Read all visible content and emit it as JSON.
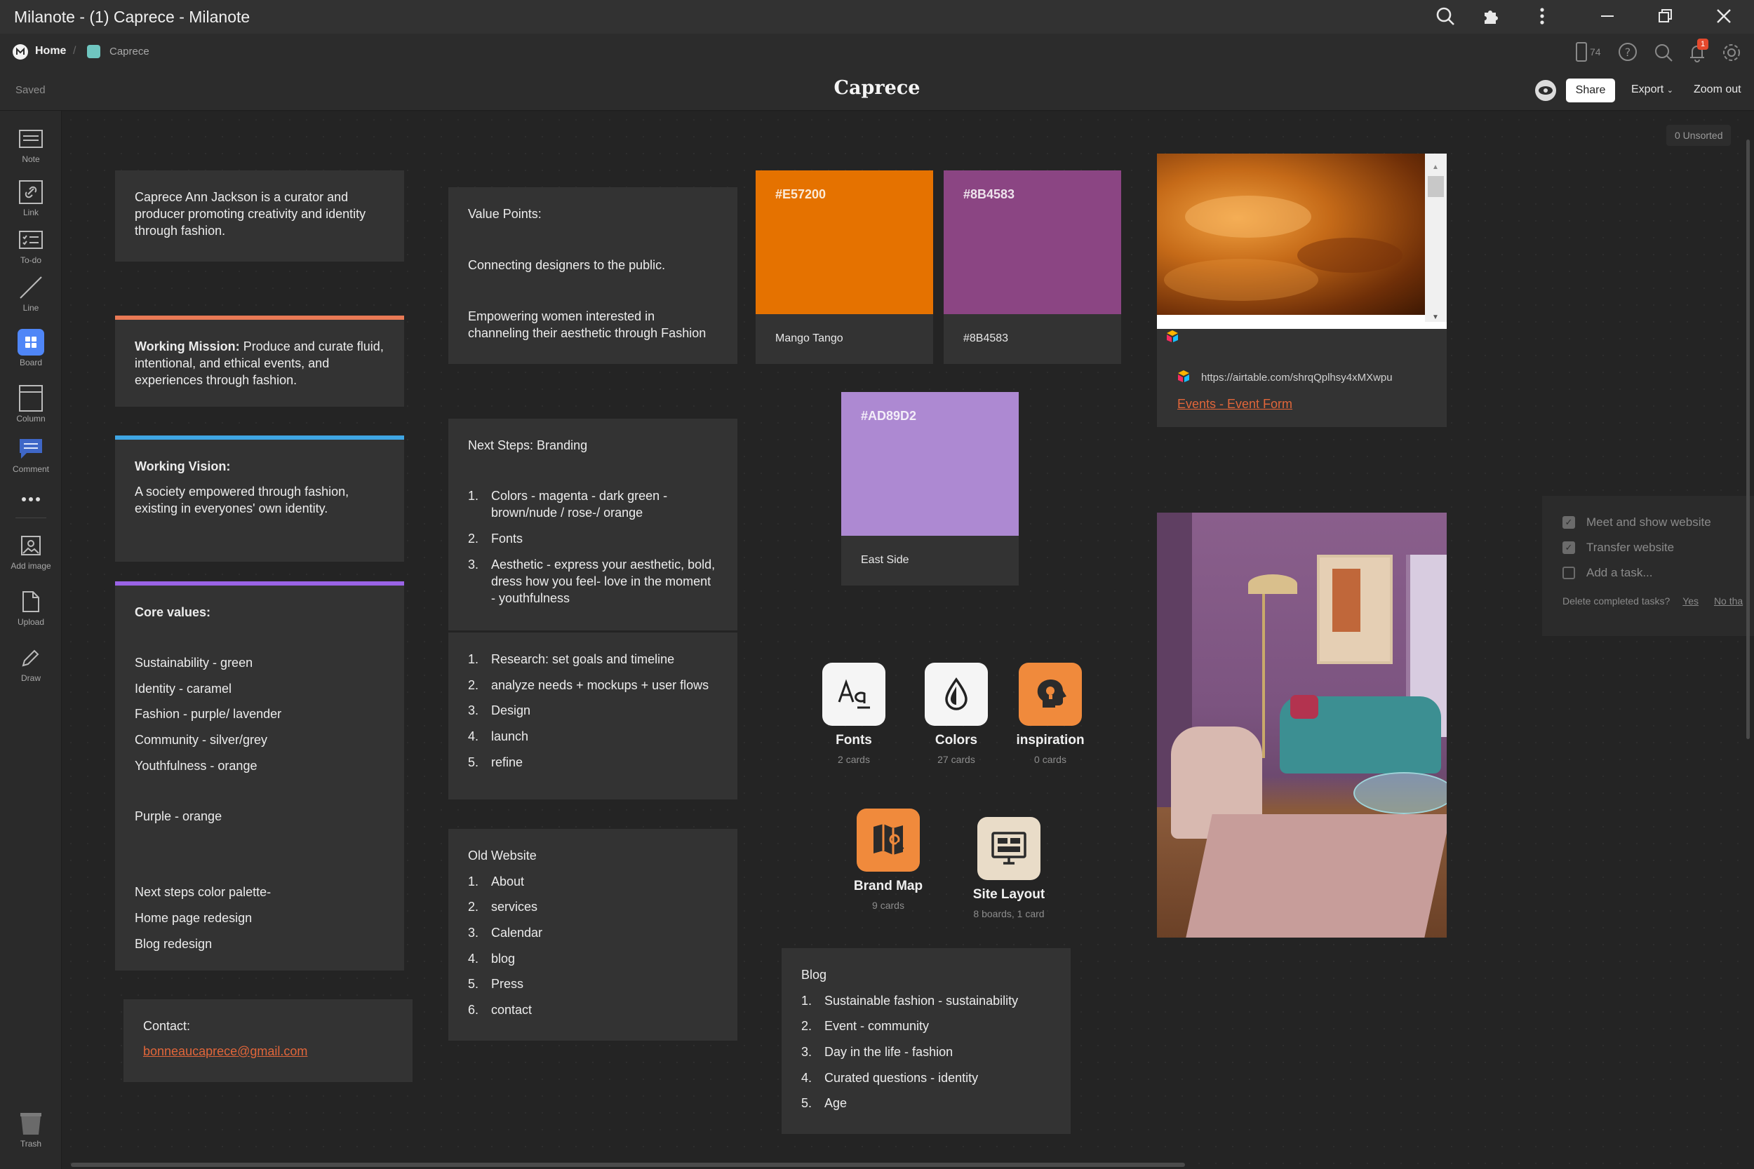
{
  "window": {
    "title": "Milanote - (1) Caprece - Milanote"
  },
  "breadcrumb": {
    "home": "Home",
    "board": "Caprece"
  },
  "header": {
    "saved": "Saved",
    "board_title": "Caprece",
    "share": "Share",
    "export": "Export",
    "zoom": "Zoom out",
    "device_count": "74",
    "notification_count": "1",
    "unsorted": "0 Unsorted"
  },
  "sidebar": {
    "tools": [
      "Note",
      "Link",
      "To-do",
      "Line",
      "Board",
      "Column",
      "Comment",
      "Add image",
      "Upload",
      "Draw"
    ],
    "trash": "Trash"
  },
  "cards": {
    "intro": "Caprece Ann Jackson is a curator and producer promoting creativity and identity through fashion.",
    "mission_label": "Working Mission:",
    "mission_text": "Produce and curate fluid, intentional, and ethical events, and experiences through fashion.",
    "vision_label": "Working Vision:",
    "vision_text": "A society empowered through fashion, existing in everyones' own identity.",
    "core_title": "Core values:",
    "core_items": [
      "Sustainability - green",
      "Identity - caramel",
      "Fashion - purple/ lavender",
      "Community - silver/grey",
      "Youthfulness - orange"
    ],
    "core_purple": "Purple - orange",
    "core_next": [
      "Next steps color palette-",
      "Home page redesign",
      "Blog redesign"
    ],
    "contact_label": "Contact:",
    "contact_email": "bonneaucaprece@gmail.com",
    "value_title": "Value Points:",
    "value_1": "Connecting designers to the public.",
    "value_2": "Empowering women interested in channeling their aesthetic through Fashion",
    "next_title": "Next Steps:  Branding",
    "next_items": [
      "Colors - magenta - dark green - brown/nude / rose-/ orange",
      "Fonts",
      "Aesthetic - express your aesthetic, bold, dress how you feel- love in the moment - youthfulness"
    ],
    "research_items": [
      "Research: set goals and timeline",
      "analyze needs + mockups + user flows",
      "Design",
      "launch",
      "refine"
    ],
    "old_title": "Old Website",
    "old_items": [
      "About",
      "services",
      "Calendar",
      "blog",
      "Press",
      "contact"
    ],
    "blog_title": "Blog",
    "blog_items": [
      "Sustainable fashion - sustainability",
      "Event - community",
      "Day in the life - fashion",
      "Curated questions  - identity",
      "Age"
    ]
  },
  "swatches": [
    {
      "hex": "#E57200",
      "name": "Mango Tango",
      "color": "#E57200"
    },
    {
      "hex": "#8B4583",
      "name": "#8B4583",
      "color": "#8B4583"
    },
    {
      "hex": "#AD89D2",
      "name": "East Side",
      "color": "#AD89D2"
    }
  ],
  "boards": [
    {
      "title": "Fonts",
      "sub": "2 cards",
      "icon": "font-icon",
      "color": "#f5f5f5"
    },
    {
      "title": "Colors",
      "sub": "27 cards",
      "icon": "droplet-icon",
      "color": "#f5f5f5"
    },
    {
      "title": "inspiration",
      "sub": "0 cards",
      "icon": "head-icon",
      "color": "#F08A3C"
    },
    {
      "title": "Brand Map",
      "sub": "9 cards",
      "icon": "map-icon",
      "color": "#F08A3C"
    },
    {
      "title": "Site Layout",
      "sub": "8 boards, 1 card",
      "icon": "layout-icon",
      "color": "#E9DCC8"
    }
  ],
  "link_card": {
    "url": "https://airtable.com/shrqQplhsy4xMXwpu",
    "title": "Events - Event Form"
  },
  "tasks": {
    "items": [
      {
        "label": "Meet and show website",
        "done": true
      },
      {
        "label": "Transfer website",
        "done": true
      }
    ],
    "add": "Add a task...",
    "delete_prompt": "Delete completed tasks?",
    "yes": "Yes",
    "no": "No tha"
  }
}
